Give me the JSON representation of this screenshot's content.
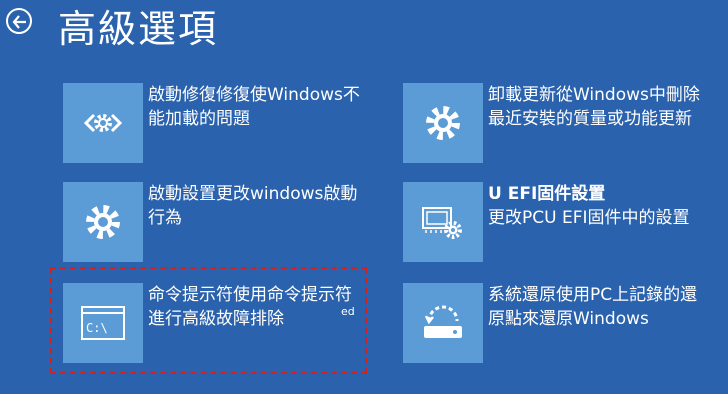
{
  "header": {
    "title": "高級選項"
  },
  "options": [
    {
      "id": "startup-repair",
      "icon": "code-brackets-gear-icon",
      "text": "啟動修復修復使Windows不能加載的問題"
    },
    {
      "id": "uninstall-updates",
      "icon": "gear-icon",
      "text": "卸載更新從Windows中刪除最近安裝的質量或功能更新"
    },
    {
      "id": "startup-settings",
      "icon": "gear-icon",
      "text": "啟動設置更改windows啟動行為"
    },
    {
      "id": "uefi-firmware",
      "icon": "firmware-chip-gear-icon",
      "title": "U EFI固件設置",
      "text": "更改PCU EFI固件中的設置"
    },
    {
      "id": "command-prompt",
      "icon": "command-prompt-icon",
      "text": "命令提示符使用命令提示符進行高級故障排除",
      "icon_text": "C:\\",
      "extra": "ed"
    },
    {
      "id": "system-restore",
      "icon": "system-restore-icon",
      "text": "系統還原使用PC上記錄的還原點來還原Windows"
    }
  ],
  "colors": {
    "background": "#2a62ad",
    "tile": "#5b9bd6",
    "highlight": "#d62020"
  }
}
